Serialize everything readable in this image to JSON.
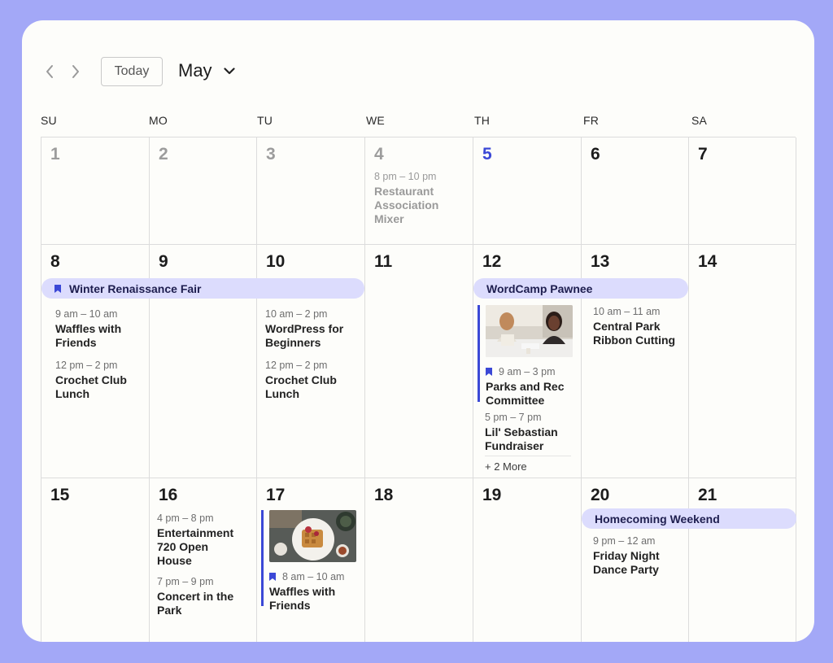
{
  "toolbar": {
    "today_label": "Today",
    "month_label": "May"
  },
  "weekdays": [
    "SU",
    "MO",
    "TU",
    "WE",
    "TH",
    "FR",
    "SA"
  ],
  "days": {
    "d1": "1",
    "d2": "2",
    "d3": "3",
    "d4": "4",
    "d5": "5",
    "d6": "6",
    "d7": "7",
    "d8": "8",
    "d9": "9",
    "d10": "10",
    "d11": "11",
    "d12": "12",
    "d13": "13",
    "d14": "14",
    "d15": "15",
    "d16": "16",
    "d17": "17",
    "d18": "18",
    "d19": "19",
    "d20": "20",
    "d21": "21"
  },
  "multi_day_events": {
    "winter_fair": "Winter Renaissance Fair",
    "wordcamp": "WordCamp Pawnee",
    "homecoming": "Homecoming Weekend"
  },
  "events": {
    "restaurant_mixer": {
      "time": "8 pm – 10 pm",
      "title": "Restaurant Association Mixer"
    },
    "waffles_8": {
      "time": "9 am – 10 am",
      "title": "Waffles with Friends"
    },
    "crochet_8": {
      "time": "12 pm – 2 pm",
      "title": "Crochet Club Lunch"
    },
    "wordpress_10": {
      "time": "10 am – 2 pm",
      "title": "WordPress for Beginners"
    },
    "crochet_10": {
      "time": "12 pm – 2 pm",
      "title": "Crochet Club Lunch"
    },
    "parks_rec": {
      "time": "9 am – 3 pm",
      "title": "Parks and Rec Committee"
    },
    "lil_sebastian": {
      "time": "5 pm – 7 pm",
      "title": "Lil' Sebastian Fundraiser"
    },
    "central_park": {
      "time": "10 am – 11 am",
      "title": "Central Park Ribbon Cutting"
    },
    "entertainment_720": {
      "time": "4 pm – 8 pm",
      "title": "Entertainment 720 Open House"
    },
    "concert_park": {
      "time": "7 pm – 9 pm",
      "title": "Concert in the Park"
    },
    "waffles_17": {
      "time": "8 am – 10 am",
      "title": "Waffles with Friends"
    },
    "friday_dance": {
      "time": "9 pm – 12 am",
      "title": "Friday Night Dance Party"
    }
  },
  "more_link": "+ 2 More",
  "icons": {
    "prev": "chevron-left-icon",
    "next": "chevron-right-icon",
    "dropdown": "chevron-down-icon",
    "bookmark": "bookmark-icon"
  },
  "colors": {
    "background": "#a3a8f7",
    "accent": "#3b48d6",
    "span_bar": "#dcdcfd",
    "today_text": "#3b48d6",
    "past_text": "#9c9c9c"
  }
}
